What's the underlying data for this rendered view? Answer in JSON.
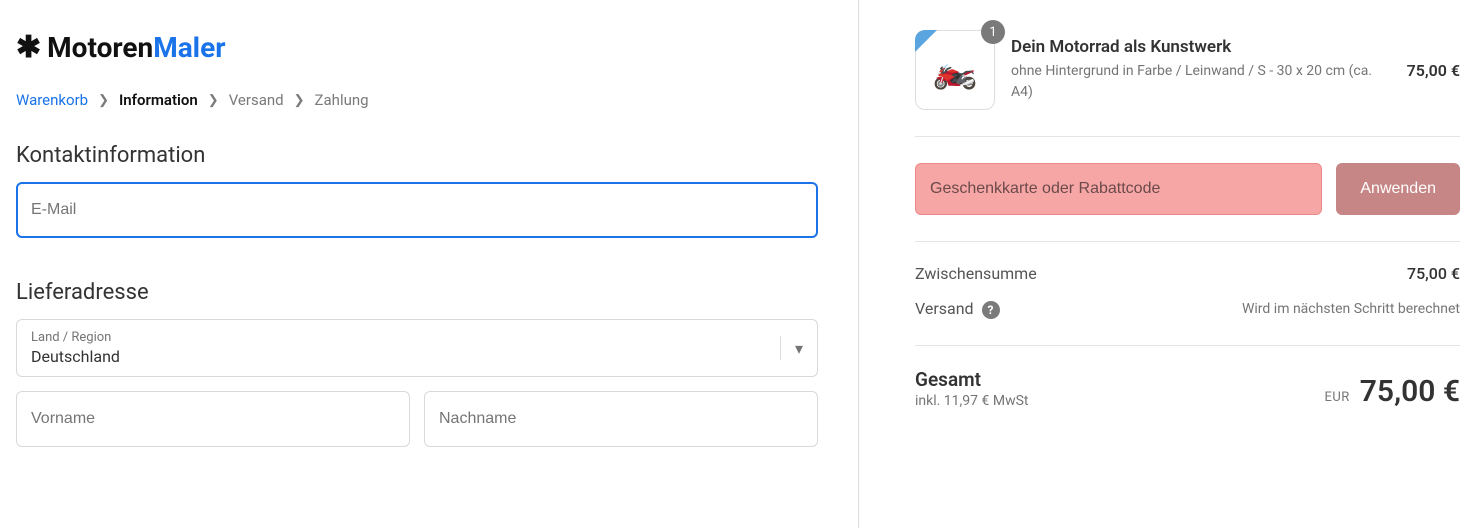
{
  "logo": {
    "part1": "Motoren",
    "part2": "Maler"
  },
  "breadcrumb": {
    "cart": "Warenkorb",
    "information": "Information",
    "shipping": "Versand",
    "payment": "Zahlung"
  },
  "sections": {
    "contact": "Kontaktinformation",
    "shipping": "Lieferadresse"
  },
  "fields": {
    "email_placeholder": "E-Mail",
    "country_label": "Land / Region",
    "country_value": "Deutschland",
    "firstname_placeholder": "Vorname",
    "lastname_placeholder": "Nachname"
  },
  "cart": {
    "items": [
      {
        "qty": "1",
        "title": "Dein Motorrad als Kunstwerk",
        "subtitle": "ohne Hintergrund in Farbe / Leinwand / S - 30 x 20 cm (ca. A4)",
        "price": "75,00 €"
      }
    ],
    "discount_placeholder": "Geschenkkarte oder Rabattcode",
    "apply_label": "Anwenden",
    "subtotal_label": "Zwischensumme",
    "subtotal_value": "75,00 €",
    "shipping_label": "Versand",
    "shipping_value": "Wird im nächsten Schritt berechnet",
    "total_label": "Gesamt",
    "tax_line": "inkl. 11,97 € MwSt",
    "currency": "EUR",
    "total_value": "75,00 €"
  }
}
